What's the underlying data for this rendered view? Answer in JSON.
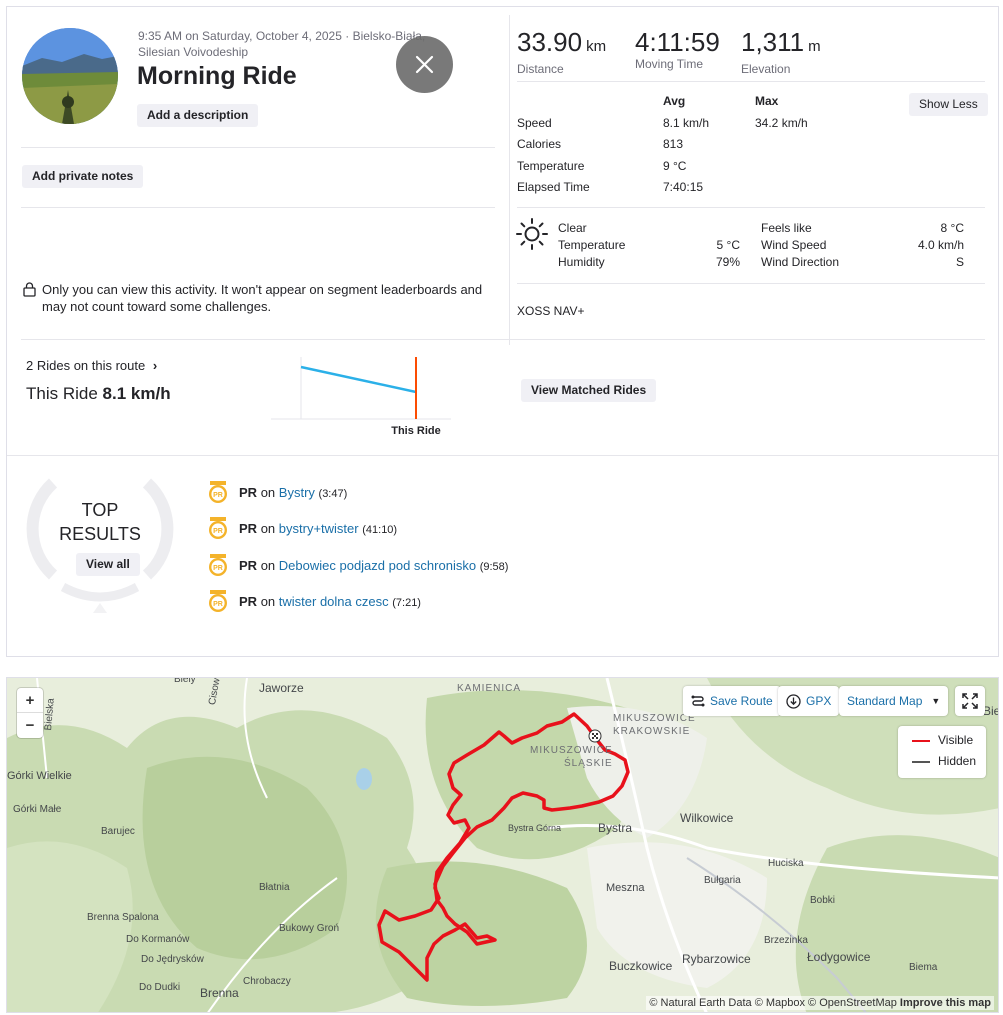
{
  "activity": {
    "meta": "9:35 AM on Saturday, October 4, 2025 · Bielsko-Biała, Silesian Voivodeship",
    "title": "Morning Ride",
    "add_description": "Add a description",
    "add_private_notes": "Add private notes",
    "privacy_notice": "Only you can view this activity. It won't appear on segment leaderboards and may not count toward some challenges."
  },
  "stats": {
    "distance": {
      "value": "33.90",
      "unit": "km",
      "label": "Distance"
    },
    "moving_time": {
      "value": "4:11:59",
      "label": "Moving Time"
    },
    "elevation": {
      "value": "1,311",
      "unit": "m",
      "label": "Elevation"
    }
  },
  "details": {
    "col_avg": "Avg",
    "col_max": "Max",
    "show_less": "Show Less",
    "rows": [
      {
        "label": "Speed",
        "avg": "8.1 km/h",
        "max": "34.2 km/h"
      },
      {
        "label": "Calories",
        "avg": "813",
        "max": ""
      },
      {
        "label": "Temperature",
        "avg": "9 °C",
        "max": ""
      },
      {
        "label": "Elapsed Time",
        "avg": "7:40:15",
        "max": ""
      }
    ]
  },
  "weather": {
    "condition": "Clear",
    "icon": "sun-icon",
    "temperature_label": "Temperature",
    "temperature": "5 °C",
    "humidity_label": "Humidity",
    "humidity": "79%",
    "feels_like_label": "Feels like",
    "feels_like": "8 °C",
    "wind_speed_label": "Wind Speed",
    "wind_speed": "4.0 km/h",
    "wind_direction_label": "Wind Direction",
    "wind_direction": "S"
  },
  "device": "XOSS NAV+",
  "matched": {
    "rides_on_route": "2 Rides on this route",
    "this_ride_label": "This Ride",
    "this_ride_value": "8.1 km/h",
    "chart_marker_label": "This Ride",
    "view_matched": "View Matched Rides"
  },
  "chart_data": {
    "type": "line",
    "x": [
      1,
      2
    ],
    "series": [
      {
        "values": [
          9.0,
          8.1
        ]
      }
    ],
    "annotations": [
      "This Ride"
    ]
  },
  "top_results": {
    "line1": "TOP",
    "line2": "RESULTS",
    "view_all": "View all",
    "items": [
      {
        "badge": "PR",
        "on": "on",
        "segment": "Bystry",
        "time": "(3:47)"
      },
      {
        "badge": "PR",
        "on": "on",
        "segment": "bystry+twister",
        "time": "(41:10)"
      },
      {
        "badge": "PR",
        "on": "on",
        "segment": "Debowiec podjazd pod schronisko",
        "time": "(9:58)"
      },
      {
        "badge": "PR",
        "on": "on",
        "segment": "twister dolna czesc",
        "time": "(7:21)"
      }
    ]
  },
  "map": {
    "zoom_in": "+",
    "zoom_out": "−",
    "save_route": "Save Route",
    "gpx": "GPX",
    "map_style": "Standard Map",
    "legend_visible": "Visible",
    "legend_hidden": "Hidden",
    "route_color": "#e8111b",
    "attribution_prefix": "© Natural Earth Data © Mapbox © OpenStreetMap",
    "attribution_link": "Improve this map",
    "places": {
      "jaworze": "Jaworze",
      "kamienica": "KAMIENICA",
      "mik_krak_1": "MIKUSZOWICE",
      "mik_krak_2": "KRAKOWSKIE",
      "mik_slask_1": "MIKUSZOWICE",
      "mik_slask_2": "ŚLĄSKIE",
      "bielsko": "Bielsk",
      "gorki_wielkie": "Górki Wielkie",
      "gorki_male": "Górki Małe",
      "barujec": "Barujec",
      "bystra_gorna": "Bystra Górna",
      "bystra": "Bystra",
      "wilkowice": "Wilkowice",
      "huciska": "Huciska",
      "bulgaria": "Bułgaria",
      "meszna": "Meszna",
      "blatnia": "Błatnia",
      "brenna_spalona": "Brenna Spalona",
      "bukowy_gron": "Bukowy Groń",
      "bobki": "Bobki",
      "do_kormanow": "Do Kormanów",
      "do_jedrysk": "Do Jędrysków",
      "brzezinka": "Brzezinka",
      "buczkowice": "Buczkowice",
      "rybarzowice": "Rybarzowice",
      "lodygowice": "Łodygowice",
      "do_dudki": "Do Dudki",
      "chrobaczy": "Chrobaczy",
      "brenna": "Brenna",
      "biema": "Biema",
      "cisowa": "Cisowa",
      "bielska": "Bielska",
      "biely": "Biely"
    }
  }
}
